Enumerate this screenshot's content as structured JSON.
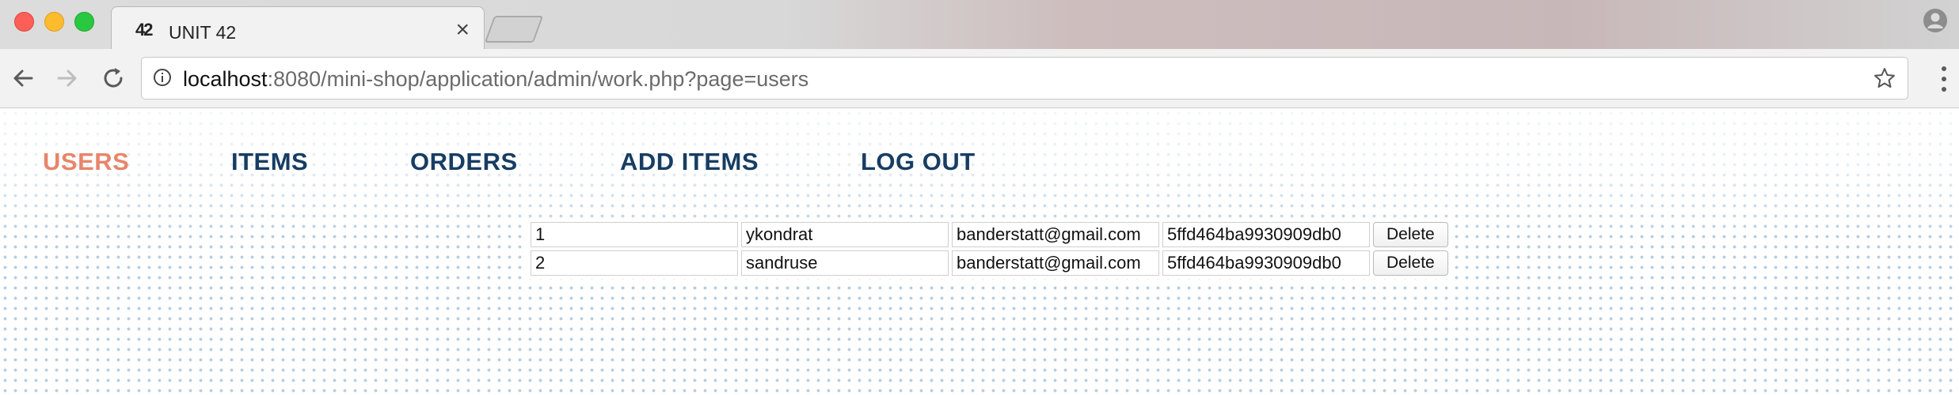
{
  "browser": {
    "tab_title": "UNIT 42",
    "tab_icon_text": "42",
    "url_host": "localhost",
    "url_rest": ":8080/mini-shop/application/admin/work.php?page=users",
    "icons": {
      "back": "back-arrow-icon",
      "forward": "forward-arrow-icon",
      "reload": "reload-icon",
      "info": "info-icon",
      "bookmark": "star-icon",
      "menu": "kebab-menu-icon",
      "profile": "profile-icon",
      "close_tab": "close-icon"
    }
  },
  "site_nav": {
    "items": [
      {
        "label": "USERS",
        "active": true
      },
      {
        "label": "ITEMS",
        "active": false
      },
      {
        "label": "ORDERS",
        "active": false
      },
      {
        "label": "ADD ITEMS",
        "active": false
      },
      {
        "label": "LOG OUT",
        "active": false
      }
    ]
  },
  "users_table": {
    "rows": [
      {
        "id": "1",
        "login": "ykondrat",
        "email": "banderstatt@gmail.com",
        "password": "5ffd464ba9930909db0",
        "action": "Delete"
      },
      {
        "id": "2",
        "login": "sandruse",
        "email": "banderstatt@gmail.com",
        "password": "5ffd464ba9930909db0",
        "action": "Delete"
      }
    ]
  },
  "colors": {
    "nav_active": "#e8856a",
    "nav_default": "#173d63",
    "dot_pattern": "#b6cde1"
  }
}
